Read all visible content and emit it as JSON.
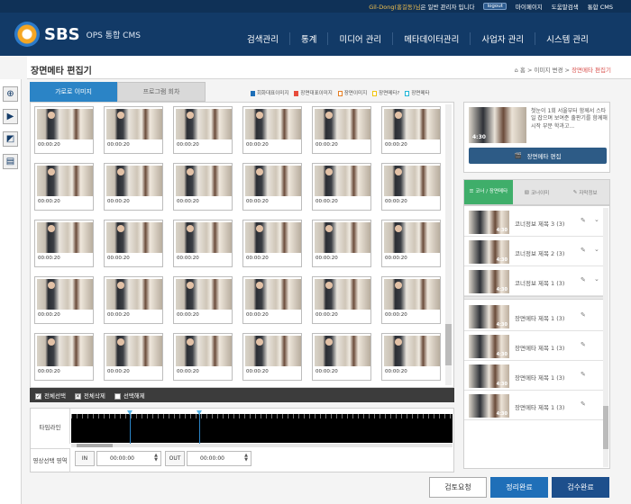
{
  "topbar": {
    "user": "Gil-Dong(홍길동)님",
    "user_suffix": "은 일반 관리자 입니다",
    "logout": "logout",
    "mypage": "마이페이지",
    "help": "도움말검색",
    "cms": "통합 CMS"
  },
  "header": {
    "logo": "SBS",
    "cms_name": "OPS 통합 CMS",
    "nav": [
      "검색관리",
      "통계",
      "미디어 관리",
      "메타데이터관리",
      "사업자 관리",
      "시스템 관리"
    ]
  },
  "page": {
    "title": "장면메타 편집기",
    "breadcrumb_home": "홈",
    "breadcrumb_mid": "이미지 변경",
    "breadcrumb_current": "장면메타 편집기"
  },
  "left_tabs": [
    "가로로 이미지",
    "프로그램 회차"
  ],
  "legend": [
    {
      "label": "회화대표이미지",
      "color": "#1f6fb8"
    },
    {
      "label": "장면대표이미지",
      "color": "#e74c3c"
    },
    {
      "label": "장면이미지",
      "color": "#e67e22"
    },
    {
      "label": "장면메타?",
      "color": "#f1c40f"
    },
    {
      "label": "장면메타",
      "color": "#1fb5d6"
    }
  ],
  "thumb_timecode": "00:00:20",
  "grid": {
    "rows": 5,
    "cols": 6
  },
  "toolbar": {
    "select_all": "전체선택",
    "delete_all": "전체삭제",
    "deselect": "선택해제"
  },
  "timeline": {
    "label": "타임라인",
    "range_label": "영상선택 영역",
    "in_label": "IN",
    "out_label": "OUT",
    "in_time": "00:00:00",
    "out_time": "00:00:00"
  },
  "preview": {
    "duration": "4:30",
    "desc": "첫눈이 1회 서울부터 함께서 스타일 잡으며 보여준 출판기를 함께해 시작 부분 학과고...",
    "edit_button": "장면메타 편집"
  },
  "right_tabs": [
    "코너 / 장면메타",
    "코너이미",
    "자막정보"
  ],
  "corners": [
    {
      "label": "코너정보 제목 3 (3)",
      "duration": "4:30"
    },
    {
      "label": "코너정보 제목 2 (3)",
      "duration": "4:30"
    },
    {
      "label": "코너정보 제목 1 (3)",
      "duration": "4:30"
    }
  ],
  "scenes": [
    {
      "label": "장면메타 제목 1 (3)",
      "duration": "4:30"
    },
    {
      "label": "장면메타 제목 1 (3)",
      "duration": "4:30"
    },
    {
      "label": "장면메타 제목 1 (3)",
      "duration": "4:30"
    },
    {
      "label": "장면메타 제목 1 (3)",
      "duration": "4:30"
    }
  ],
  "buttons": {
    "review": "검토요청",
    "confirm": "정리완료",
    "approve": "검수완료"
  }
}
